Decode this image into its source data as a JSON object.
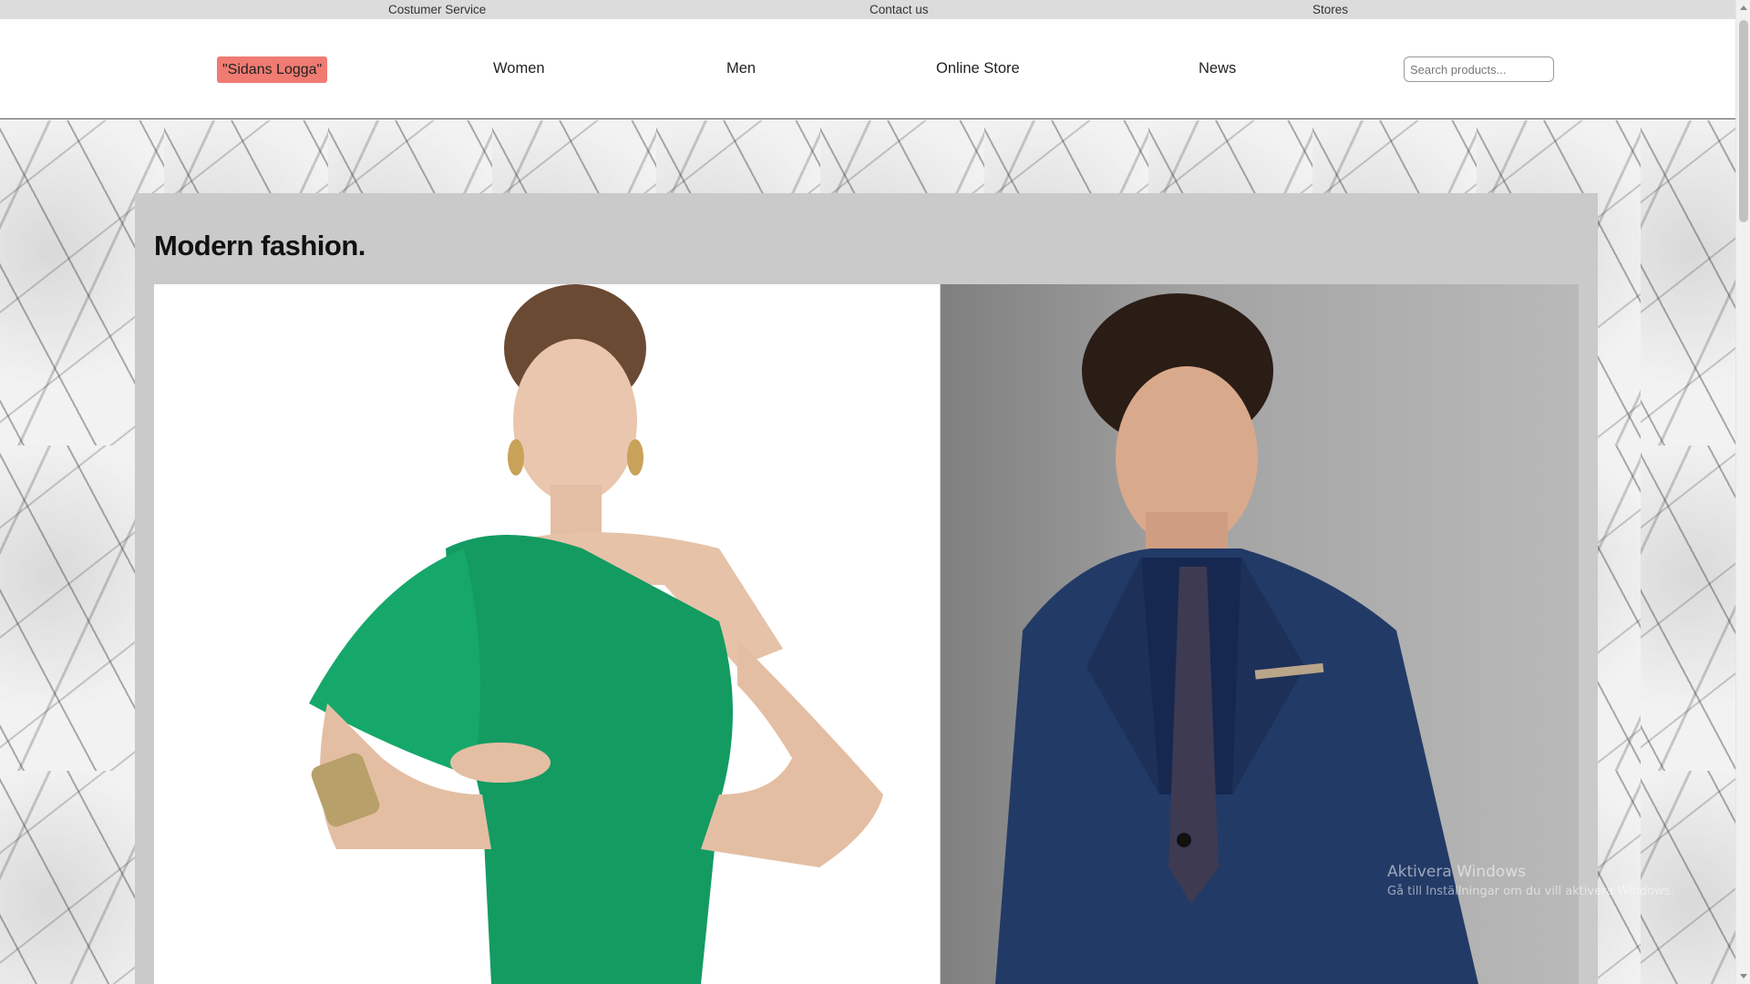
{
  "utility_bar": {
    "links": [
      "Costumer Service",
      "Contact us",
      "Stores"
    ]
  },
  "header": {
    "logo_label": "\"Sidans Logga\"",
    "nav": [
      "Women",
      "Men",
      "Online Store",
      "News"
    ],
    "search_placeholder": "Search products..."
  },
  "content": {
    "title": "Modern fashion."
  },
  "watermark": {
    "title": "Aktivera Windows",
    "subtitle": "Gå till Inställningar om du vill aktivera Windows."
  },
  "colors": {
    "logo_background": "#f07b72",
    "panel_background": "#cacaca",
    "dress": "#139b62",
    "suit": "#223a66"
  }
}
